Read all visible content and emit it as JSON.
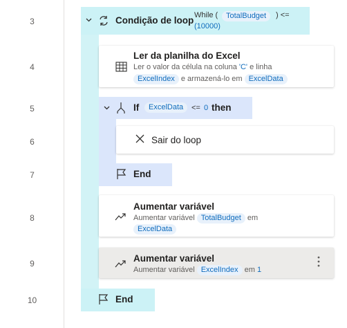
{
  "line_numbers": [
    "3",
    "4",
    "5",
    "6",
    "7",
    "8",
    "9",
    "10"
  ],
  "loop": {
    "title": "Condição de loop",
    "while_kw": "While (",
    "var": "TotalBudget",
    "op": ") <=",
    "value": "(10000)"
  },
  "read_excel": {
    "title": "Ler da planilha do Excel",
    "desc_prefix": "Ler o valor da célula na coluna",
    "column": "'C'",
    "desc_mid": "e linha",
    "row_var": "ExcelIndex",
    "desc_store": "e armazená-lo em",
    "store_var": "ExcelData"
  },
  "if_block": {
    "kw": "If",
    "var": "ExcelData",
    "op": "<=",
    "value": "0",
    "then": "then"
  },
  "exit_loop": {
    "title": "Sair do loop"
  },
  "if_end": {
    "label": "End"
  },
  "increase1": {
    "title": "Aumentar variável",
    "prefix": "Aumentar variável",
    "var": "TotalBudget",
    "mid": "em",
    "value_var": "ExcelData"
  },
  "increase2": {
    "title": "Aumentar variável",
    "prefix": "Aumentar variável",
    "var": "ExcelIndex",
    "mid": "em",
    "value": "1"
  },
  "loop_end": {
    "label": "End"
  },
  "colors": {
    "loop_block": "#ccf2f6",
    "if_block": "#dbe6fb",
    "token_bg": "#e8f1fb",
    "token_text": "#0f6cbd"
  }
}
